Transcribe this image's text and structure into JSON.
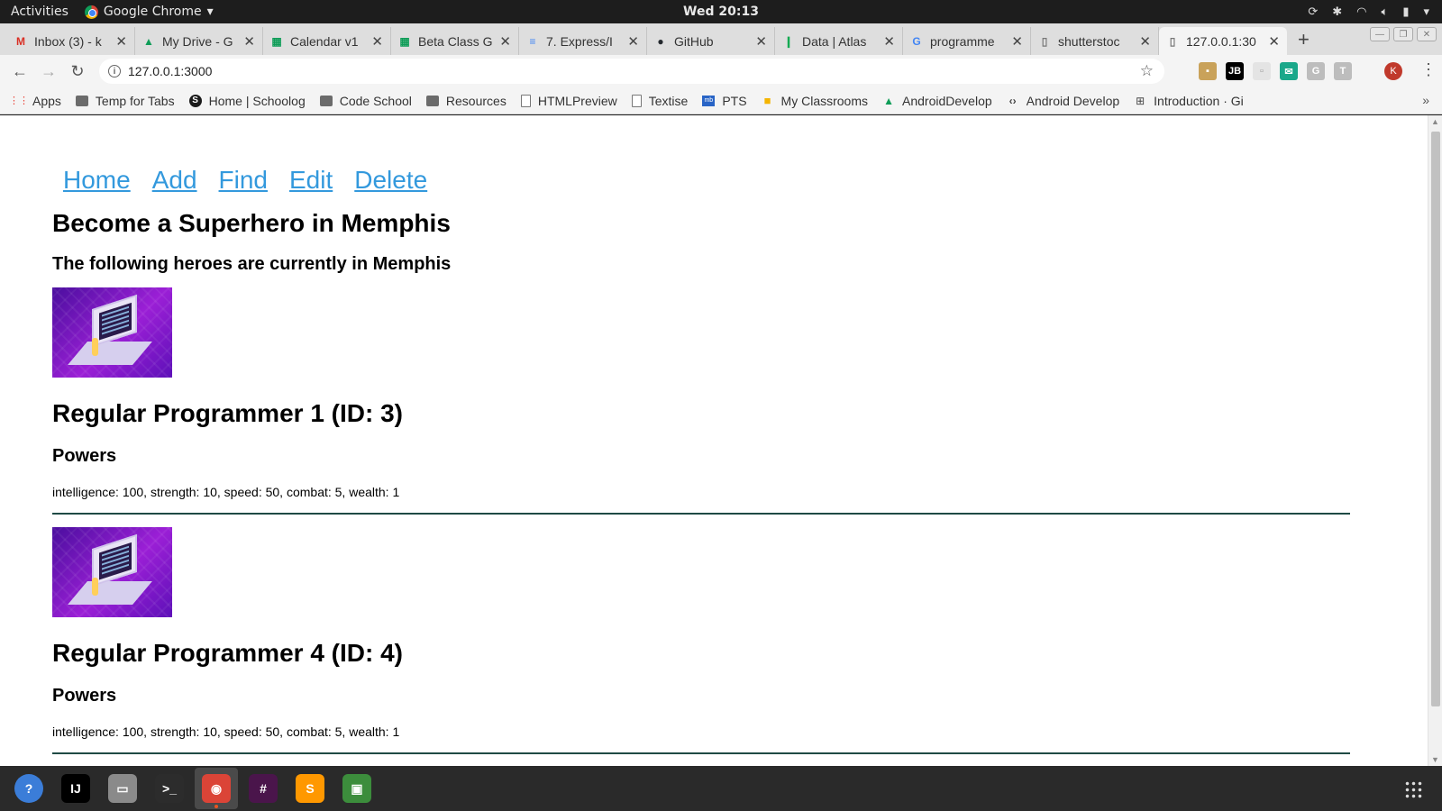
{
  "desktop": {
    "activities": "Activities",
    "app_name": "Google Chrome",
    "clock": "Wed 20:13"
  },
  "browser": {
    "tabs": [
      {
        "title": "Inbox (3) - k",
        "icon": "gmail-icon",
        "color": "#d93025",
        "glyph": "M"
      },
      {
        "title": "My Drive - G",
        "icon": "drive-icon",
        "color": "#0f9d58",
        "glyph": "▲"
      },
      {
        "title": "Calendar v1",
        "icon": "sheets-icon",
        "color": "#0f9d58",
        "glyph": "▦"
      },
      {
        "title": "Beta Class G",
        "icon": "sheets-icon",
        "color": "#0f9d58",
        "glyph": "▦"
      },
      {
        "title": "7. Express/I",
        "icon": "docs-icon",
        "color": "#4285f4",
        "glyph": "≡"
      },
      {
        "title": "GitHub",
        "icon": "github-icon",
        "color": "#24292e",
        "glyph": "●"
      },
      {
        "title": "Data | Atlas",
        "icon": "mongodb-icon",
        "color": "#13aa52",
        "glyph": "❙"
      },
      {
        "title": "programme",
        "icon": "google-icon",
        "color": "#4285f4",
        "glyph": "G"
      },
      {
        "title": "shutterstoc",
        "icon": "page-icon",
        "color": "#777777",
        "glyph": "▯"
      },
      {
        "title": "127.0.0.1:30",
        "icon": "page-icon",
        "color": "#777777",
        "glyph": "▯",
        "active": true
      }
    ],
    "url": "127.0.0.1:3000",
    "profile_initial": "K",
    "bookmarks": [
      {
        "label": "Apps",
        "type": "apps"
      },
      {
        "label": "Temp for Tabs",
        "type": "folder"
      },
      {
        "label": "Home | Schoolog",
        "type": "schoology"
      },
      {
        "label": "Code School",
        "type": "folder"
      },
      {
        "label": "Resources",
        "type": "folder"
      },
      {
        "label": "HTMLPreview",
        "type": "page"
      },
      {
        "label": "Textise",
        "type": "page"
      },
      {
        "label": "PTS",
        "type": "pts"
      },
      {
        "label": "My Classrooms",
        "type": "classroom"
      },
      {
        "label": "AndroidDevelop",
        "type": "drive"
      },
      {
        "label": "Android Develop",
        "type": "code"
      },
      {
        "label": "Introduction · Gi",
        "type": "book"
      }
    ],
    "bookmarks_more": "»"
  },
  "page": {
    "nav": [
      "Home",
      "Add",
      "Find",
      "Edit",
      "Delete"
    ],
    "title": "Become a Superhero in Memphis",
    "subtitle": "The following heroes are currently in Memphis",
    "heroes": [
      {
        "name": "Regular Programmer 1 (ID: 3)",
        "powers_heading": "Powers",
        "powers": "intelligence: 100, strength: 10, speed: 50, combat: 5, wealth: 1"
      },
      {
        "name": "Regular Programmer 4 (ID: 4)",
        "powers_heading": "Powers",
        "powers": "intelligence: 100, strength: 10, speed: 50, combat: 5, wealth: 1"
      }
    ],
    "link_color": "#3399dd",
    "rule_color": "#1f4a44"
  },
  "dock": [
    {
      "name": "help-icon",
      "glyph": "?",
      "color": "#3b7dd8"
    },
    {
      "name": "intellij-icon",
      "glyph": "IJ",
      "color": "#000000"
    },
    {
      "name": "files-icon",
      "glyph": "▭",
      "color": "#8a8a8a"
    },
    {
      "name": "terminal-icon",
      "glyph": ">_",
      "color": "#2c2c2c"
    },
    {
      "name": "chrome-icon",
      "glyph": "◉",
      "color": "#db4437",
      "active": true
    },
    {
      "name": "slack-icon",
      "glyph": "#",
      "color": "#4a154b"
    },
    {
      "name": "sublime-icon",
      "glyph": "S",
      "color": "#ff9800"
    },
    {
      "name": "monitor-icon",
      "glyph": "▣",
      "color": "#3c8d3c"
    }
  ]
}
